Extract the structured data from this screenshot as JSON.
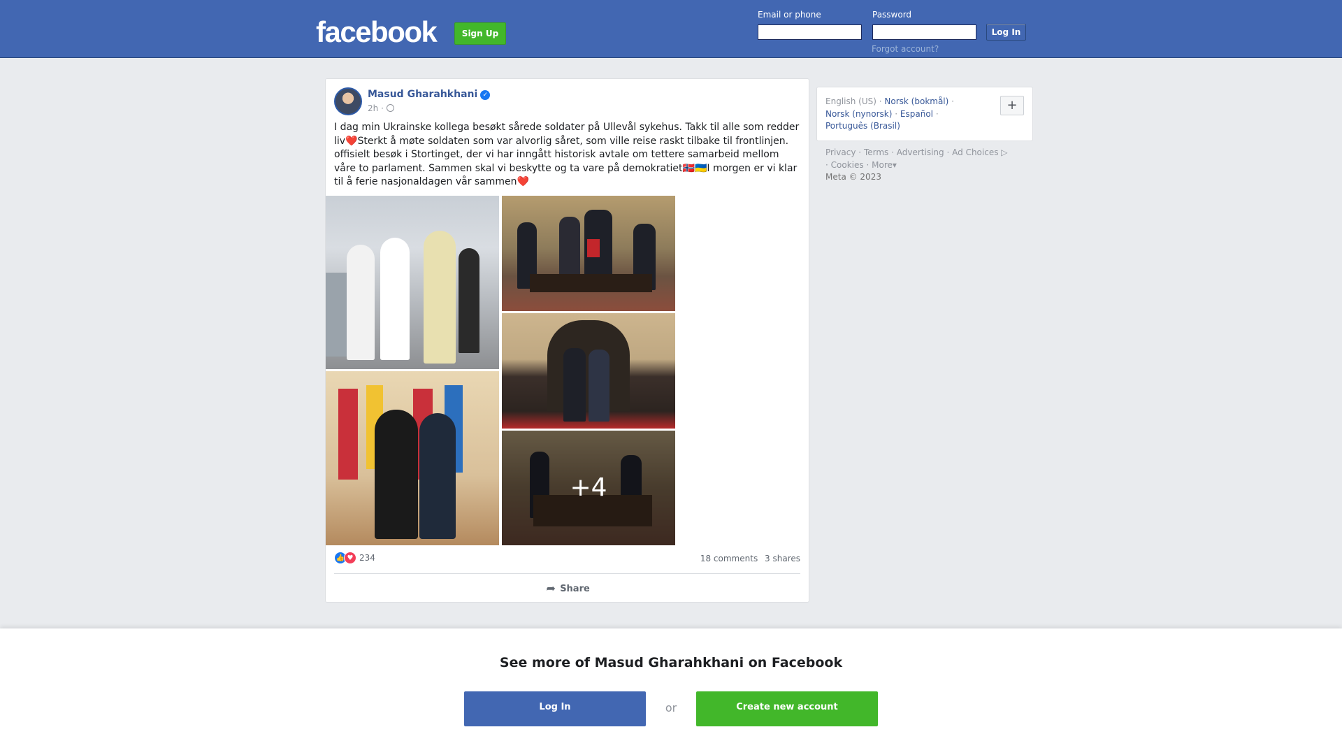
{
  "header": {
    "logo": "facebook",
    "signup_label": "Sign Up",
    "email_label": "Email or phone",
    "password_label": "Password",
    "login_label": "Log In",
    "forgot_label": "Forgot account?"
  },
  "post": {
    "author": "Masud Gharahkhani",
    "verified_icon": "verified-badge-icon",
    "time": "2h",
    "separator": "·",
    "text": "I dag min Ukrainske kollega besøkt sårede soldater på Ullevål sykehus. Takk til alle som redder liv❤️Sterkt å møte soldaten som var alvorlig såret, som ville reise raskt tilbake til frontlinjen. offisielt besøk i Stortinget, der vi har inngått historisk avtale om tettere samarbeid mellom våre to parlament. Sammen skal vi beskytte og ta vare på demokratiet🇳🇴🇺🇦I morgen er vi klar til å ferie nasjonaldagen vår sammen❤️",
    "more_photos": "+4",
    "reaction_count": "234",
    "comments": "18 comments",
    "shares": "3 shares",
    "share_label": "Share"
  },
  "languages": {
    "current": "English (US)",
    "links": [
      "Norsk (bokmål)",
      "Norsk (nynorsk)",
      "Español",
      "Português (Brasil)"
    ],
    "separator": "·",
    "plus": "+"
  },
  "footer": {
    "links": [
      "Privacy",
      "Terms",
      "Advertising",
      "Ad Choices",
      "Cookies",
      "More"
    ],
    "separator": "·",
    "copyright": "Meta © 2023"
  },
  "bottom": {
    "title": "See more of Masud Gharahkhani on Facebook",
    "login_label": "Log In",
    "or_label": "or",
    "create_label": "Create new account"
  },
  "colors": {
    "brand_blue": "#4267b2",
    "green": "#42b72a",
    "link": "#385898"
  }
}
